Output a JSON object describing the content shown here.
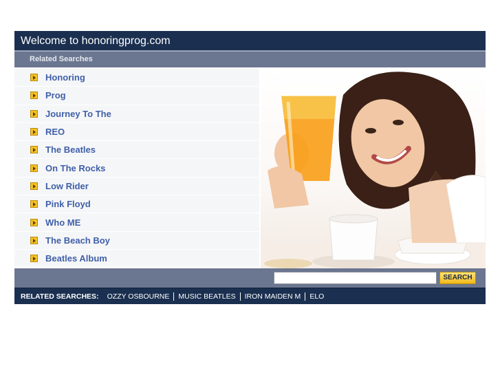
{
  "header": {
    "title": "Welcome to honoringprog.com"
  },
  "subheader": {
    "label": "Related Searches"
  },
  "links": [
    {
      "label": "Honoring"
    },
    {
      "label": "Prog"
    },
    {
      "label": "Journey To The"
    },
    {
      "label": "REO"
    },
    {
      "label": "The Beatles"
    },
    {
      "label": "On The Rocks"
    },
    {
      "label": "Low Rider"
    },
    {
      "label": "Pink Floyd"
    },
    {
      "label": "Who ME"
    },
    {
      "label": "The Beach Boy"
    },
    {
      "label": "Beatles Album"
    }
  ],
  "search": {
    "value": "",
    "button_label": "SEARCH"
  },
  "footer": {
    "label": "RELATED SEARCHES:",
    "links": [
      "OZZY OSBOURNE",
      "MUSIC BEATLES",
      "IRON MAIDEN M",
      "ELO"
    ]
  },
  "colors": {
    "header_bg": "#1b3050",
    "subheader_bg": "#6b7690",
    "link_text": "#3f5fa8",
    "search_button": "#f1b918"
  },
  "icons": {
    "link_bullet": "arrow-bullet-icon"
  }
}
